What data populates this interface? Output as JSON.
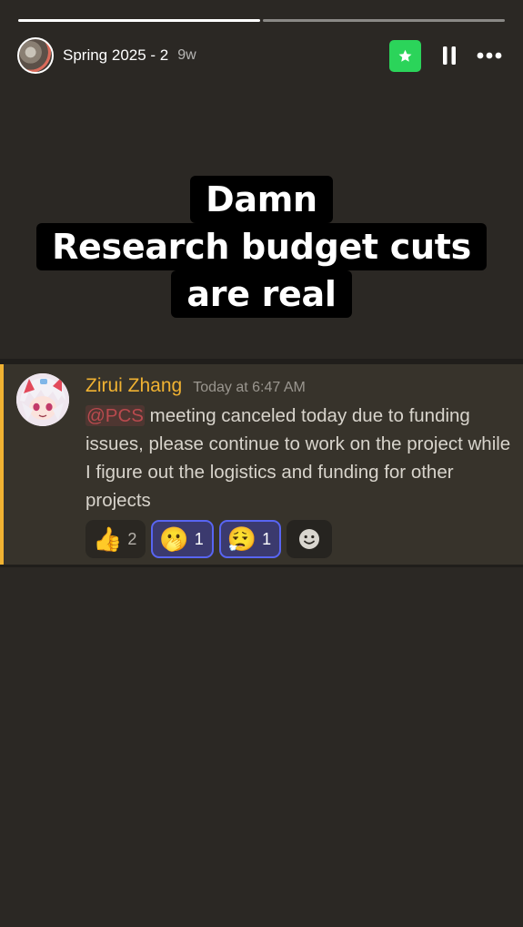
{
  "story": {
    "title": "Spring 2025 - 2",
    "age": "9w",
    "segments_total": 2,
    "segments_done": 1
  },
  "header": {
    "star_icon": "star-icon",
    "pause_icon": "pause-icon",
    "more_icon": "more-horizontal-icon",
    "accent_color": "#2bd45a"
  },
  "caption": {
    "lines": [
      "Damn",
      "Research budget cuts",
      "are real"
    ]
  },
  "message": {
    "author": "Zirui Zhang",
    "author_color": "#f0b232",
    "timestamp": "Today at 6:47 AM",
    "mention": "@PCS",
    "text": " meeting canceled today due to funding issues, please continue to work on the project while I figure out the logistics and funding for other projects",
    "reactions": [
      {
        "emoji": "👍",
        "count": "2",
        "reacted": false
      },
      {
        "emoji": "🫢",
        "count": "1",
        "reacted": true
      },
      {
        "emoji": "😮‍💨",
        "count": "1",
        "reacted": true
      }
    ],
    "add_reaction_icon": "add-reaction-icon"
  }
}
